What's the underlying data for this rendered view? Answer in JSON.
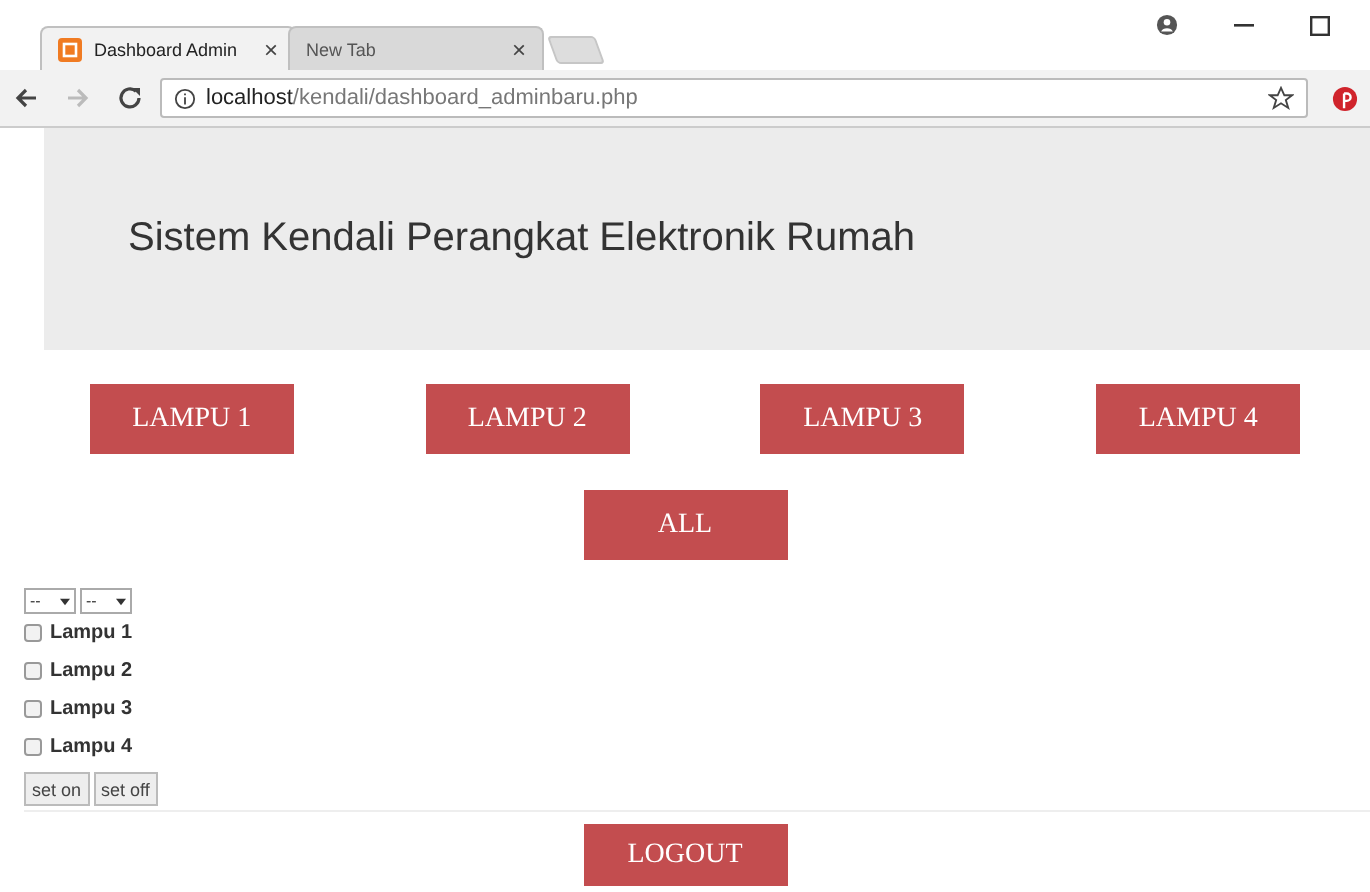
{
  "browser": {
    "tabs": [
      {
        "title": "Dashboard Admin",
        "selected": true
      },
      {
        "title": "New Tab",
        "selected": false
      }
    ],
    "close_glyph": "×",
    "url_host": "localhost",
    "url_path": "/kendali/dashboard_adminbaru.php"
  },
  "header": {
    "title": "Sistem Kendali Perangkat Elektronik Rumah"
  },
  "lamp_buttons": [
    "LAMPU 1",
    "LAMPU 2",
    "LAMPU 3",
    "LAMPU 4"
  ],
  "all_button": "ALL",
  "selects": [
    {
      "value": "--"
    },
    {
      "value": "--"
    }
  ],
  "checkboxes": [
    {
      "label": "Lampu 1",
      "checked": false
    },
    {
      "label": "Lampu 2",
      "checked": false
    },
    {
      "label": "Lampu 3",
      "checked": false
    },
    {
      "label": "Lampu 4",
      "checked": false
    }
  ],
  "action_buttons": [
    "set on",
    "set off"
  ],
  "logout_button": "LOGOUT"
}
